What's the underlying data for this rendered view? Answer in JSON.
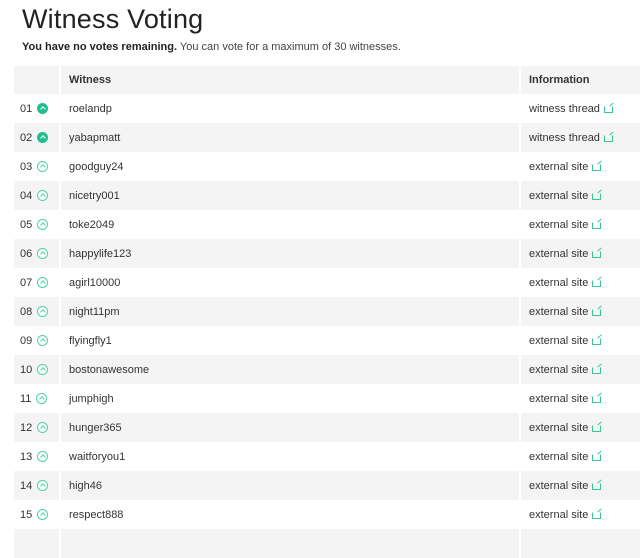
{
  "title": "Witness Voting",
  "subtitle": {
    "bold": "You have no votes remaining.",
    "rest": " You can vote for a maximum of 30 witnesses."
  },
  "table": {
    "headers": [
      "",
      "Witness",
      "Information"
    ],
    "rows": [
      {
        "rank": "01",
        "voted": true,
        "name": "roelandp",
        "info": "witness thread"
      },
      {
        "rank": "02",
        "voted": true,
        "name": "yabapmatt",
        "info": "witness thread"
      },
      {
        "rank": "03",
        "voted": false,
        "name": "goodguy24",
        "info": "external site"
      },
      {
        "rank": "04",
        "voted": false,
        "name": "nicetry001",
        "info": "external site"
      },
      {
        "rank": "05",
        "voted": false,
        "name": "toke2049",
        "info": "external site"
      },
      {
        "rank": "06",
        "voted": false,
        "name": "happylife123",
        "info": "external site"
      },
      {
        "rank": "07",
        "voted": false,
        "name": "agirl10000",
        "info": "external site"
      },
      {
        "rank": "08",
        "voted": false,
        "name": "night11pm",
        "info": "external site"
      },
      {
        "rank": "09",
        "voted": false,
        "name": "flyingfly1",
        "info": "external site"
      },
      {
        "rank": "10",
        "voted": false,
        "name": "bostonawesome",
        "info": "external site"
      },
      {
        "rank": "11",
        "voted": false,
        "name": "jumphigh",
        "info": "external site"
      },
      {
        "rank": "12",
        "voted": false,
        "name": "hunger365",
        "info": "external site"
      },
      {
        "rank": "13",
        "voted": false,
        "name": "waitforyou1",
        "info": "external site"
      },
      {
        "rank": "14",
        "voted": false,
        "name": "high46",
        "info": "external site"
      },
      {
        "rank": "15",
        "voted": false,
        "name": "respect888",
        "info": "external site"
      },
      {
        "rank": "",
        "voted": null,
        "name": "",
        "info": ""
      }
    ]
  },
  "colors": {
    "accent": "#1fbf8f",
    "stripe": "#f4f4f4"
  }
}
